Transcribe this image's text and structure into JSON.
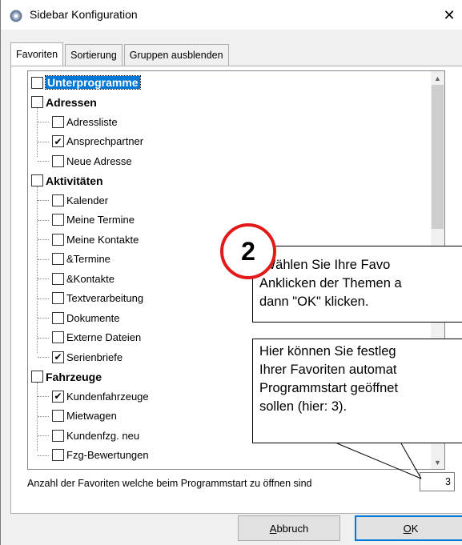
{
  "window": {
    "title": "Sidebar Konfiguration",
    "close_symbol": "✕"
  },
  "tabs": [
    {
      "label": "Favoriten",
      "active": true
    },
    {
      "label": "Sortierung",
      "active": false
    },
    {
      "label": "Gruppen ausblenden",
      "active": false
    }
  ],
  "tree": {
    "groups": [
      {
        "label": "Unterprogramme",
        "checked": false,
        "selected": true,
        "items": []
      },
      {
        "label": "Adressen",
        "checked": false,
        "items": [
          {
            "label": "Adressliste",
            "checked": false
          },
          {
            "label": "Ansprechpartner",
            "checked": true
          },
          {
            "label": "Neue Adresse",
            "checked": false
          }
        ]
      },
      {
        "label": "Aktivitäten",
        "checked": false,
        "items": [
          {
            "label": "Kalender",
            "checked": false
          },
          {
            "label": "Meine Termine",
            "checked": false
          },
          {
            "label": "Meine Kontakte",
            "checked": false
          },
          {
            "label": "&Termine",
            "checked": false
          },
          {
            "label": "&Kontakte",
            "checked": false
          },
          {
            "label": "Textverarbeitung",
            "checked": false
          },
          {
            "label": "Dokumente",
            "checked": false
          },
          {
            "label": "Externe Dateien",
            "checked": false
          },
          {
            "label": "Serienbriefe",
            "checked": true
          }
        ]
      },
      {
        "label": "Fahrzeuge",
        "checked": false,
        "items": [
          {
            "label": "Kundenfahrzeuge",
            "checked": true
          },
          {
            "label": "Mietwagen",
            "checked": false
          },
          {
            "label": "Kundenfzg. neu",
            "checked": false
          },
          {
            "label": "Fzg-Bewertungen",
            "checked": false
          }
        ]
      }
    ],
    "check_glyph": "✔"
  },
  "favorites": {
    "label": "Anzahl der Favoriten welche beim Programmstart zu öffnen sind",
    "value": "3"
  },
  "buttons": {
    "cancel_mnemonic": "A",
    "cancel_rest": "bbruch",
    "ok_mnemonic": "O",
    "ok_rest": "K"
  },
  "annotations": {
    "badge_number": "2",
    "callout1_lines": [
      " Wählen Sie Ihre Favo",
      "Anklicken der Themen a",
      "dann \"OK\" klicken."
    ],
    "callout2_lines": [
      "Hier können Sie festleg",
      "Ihrer Favoriten automat",
      "Programmstart geöffnet",
      "sollen (hier: 3)."
    ]
  },
  "colors": {
    "badge_border": "#e21a1a",
    "selection": "#0078d7"
  }
}
